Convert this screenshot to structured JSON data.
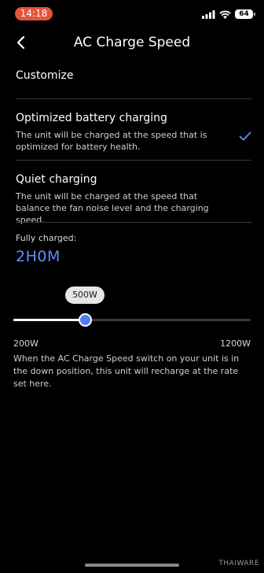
{
  "status_bar": {
    "time": "14:18",
    "battery": "64",
    "icons": [
      "signal-icon",
      "wifi-icon",
      "battery-icon"
    ]
  },
  "header": {
    "title": "AC Charge Speed",
    "back_icon": "chevron-left-icon"
  },
  "section": {
    "label": "Customize"
  },
  "options": [
    {
      "title": "Optimized battery charging",
      "description": "The unit will be charged at the speed that is optimized for battery health.",
      "selected": true
    },
    {
      "title": "Quiet charging",
      "description": "The unit will be charged at the speed that balance the fan noise level and the charging speed.",
      "selected": false
    }
  ],
  "charge": {
    "label": "Fully charged:",
    "value": "2H0M"
  },
  "slider": {
    "value_label": "500W",
    "value": 500,
    "min": 200,
    "max": 1200,
    "min_label": "200W",
    "max_label": "1200W"
  },
  "info_text": "When the AC Charge Speed switch on your unit is in the down position, this unit will recharge at the rate set here.",
  "watermark": "THAIWARE",
  "colors": {
    "accent": "#5b8fff",
    "time_pill": "#e5533d",
    "background": "#000000"
  }
}
